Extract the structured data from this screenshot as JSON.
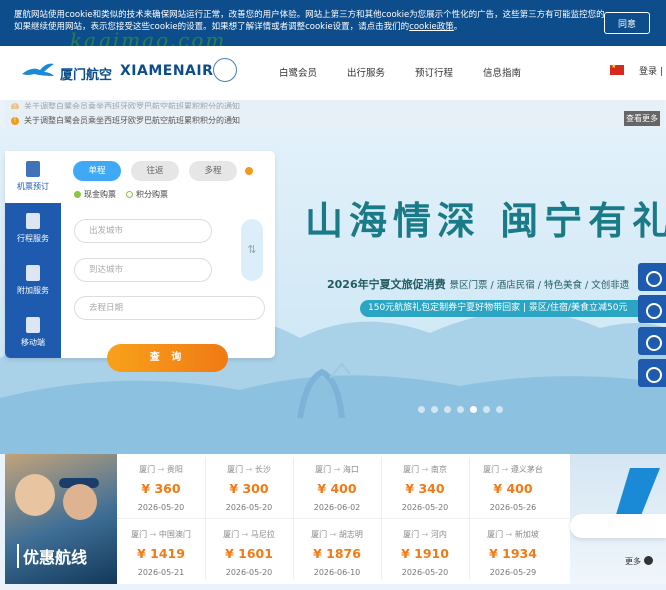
{
  "cookie_banner": {
    "line1": "厦航网站使用cookie和类似的技术来确保网站运行正常，改善您的用户体验。网站上第三方和其他cookie为您展示个性化的广告，这些第三方有可能监控您的网络行为。",
    "line2_pre": "如果继续使用网站，表示您接受这些cookie的设置。如果想了解详情或者调整cookie设置，请点击我们的",
    "policy_link": "cookie政策",
    "line2_post": "。",
    "agree_label": "同意"
  },
  "watermark": "kaqimao.com",
  "header": {
    "logo_cn": "厦门航空",
    "logo_en": "XIAMENAIR",
    "nav": [
      "白鹭会员",
      "出行服务",
      "预订行程",
      "信息指南"
    ],
    "login_label": "登录 | 注"
  },
  "notices": {
    "items": [
      "关于调整白鹭会员乘坐西班牙欧罗巴航空航班累积积分的通知"
    ],
    "more_label": "查看更多"
  },
  "booking": {
    "side_tabs": [
      "机票预订",
      "行程服务",
      "附加服务",
      "移动端"
    ],
    "trip_types": [
      "单程",
      "往返",
      "多程"
    ],
    "pay_options": [
      "现金购票",
      "积分购票"
    ],
    "depart_placeholder": "出发城市",
    "arrive_placeholder": "到达城市",
    "date_placeholder": "去程日期",
    "search_label": "查 询"
  },
  "banner": {
    "slogan": "山海情深 闽宁有礼",
    "subtitle_main": "2026年宁夏文旅促消费",
    "subtitle_rest": "景区门票 / 酒店民宿 / 特色美食 / 文创非遗",
    "promo": "150元航旅礼包定制券宁夏好物带回家 | 景区/住宿/美食立减50元"
  },
  "deals": {
    "title": "优惠航线",
    "more_label": "更多",
    "routes": [
      {
        "from": "厦门",
        "to": "贵阳",
        "price": "¥ 360",
        "date": "2026-05-20"
      },
      {
        "from": "厦门",
        "to": "长沙",
        "price": "¥ 300",
        "date": "2026-05-20"
      },
      {
        "from": "厦门",
        "to": "海口",
        "price": "¥ 400",
        "date": "2026-06-02"
      },
      {
        "from": "厦门",
        "to": "南京",
        "price": "¥ 340",
        "date": "2026-05-20"
      },
      {
        "from": "厦门",
        "to": "遵义茅台",
        "price": "¥ 400",
        "date": "2026-05-26"
      },
      {
        "from": "厦门",
        "to": "中国澳门",
        "price": "¥ 1419",
        "date": "2026-05-21"
      },
      {
        "from": "厦门",
        "to": "马尼拉",
        "price": "¥ 1601",
        "date": "2026-05-20"
      },
      {
        "from": "厦门",
        "to": "胡志明",
        "price": "¥ 1876",
        "date": "2026-06-10"
      },
      {
        "from": "厦门",
        "to": "河内",
        "price": "¥ 1910",
        "date": "2026-05-20"
      },
      {
        "from": "厦门",
        "to": "新加坡",
        "price": "¥ 1934",
        "date": "2026-05-29"
      }
    ]
  },
  "colors": {
    "brand": "#1e5bae",
    "accent": "#f07a14",
    "cookie_bg": "#0d4d8c"
  }
}
